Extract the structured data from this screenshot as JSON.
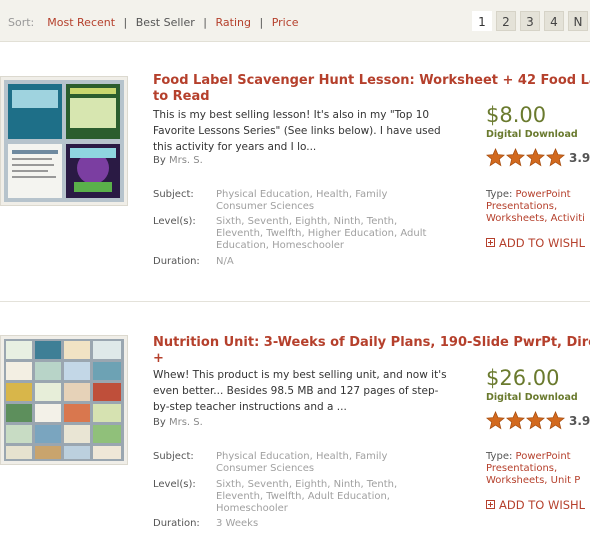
{
  "sort": {
    "label": "Sort:",
    "options": [
      "Most Recent",
      "Best Seller",
      "Rating",
      "Price"
    ],
    "separator": "|"
  },
  "pagination": {
    "pages": [
      "1",
      "2",
      "3",
      "4",
      "N"
    ],
    "current": "1"
  },
  "products": [
    {
      "title_line1": "Food Label Scavenger Hunt Lesson: Worksheet + 42 Food La",
      "title_line2": "to Read",
      "description": "This is my best selling lesson! It's also in my \"Top 10 Favorite Lessons Series\" (See links below). I have used this activity for years and I lo...",
      "by_label": "By",
      "author": "Mrs. S.",
      "subject_label": "Subject:",
      "subject": "Physical Education, Health, Family Consumer Sciences",
      "levels_label": "Level(s):",
      "levels": "Sixth, Seventh, Eighth, Ninth, Tenth, Eleventh, Twelfth, Higher Education, Adult Education, Homeschooler",
      "duration_label": "Duration:",
      "duration": "N/A",
      "price": "$8.00",
      "format": "Digital Download",
      "rating_stars": 4,
      "rating": "3.9",
      "type_label": "Type:",
      "type_line1": "PowerPoint",
      "type_line2": "Presentations,",
      "type_line3": "Worksheets, Activiti",
      "wishlist": "ADD TO WISHL"
    },
    {
      "title_line1": "Nutrition Unit: 3-Weeks of Daily Plans, 190-Slide PwrPt, Direc",
      "title_line2": "+",
      "description": "Whew! This product is my best selling unit, and now it's even better... Besides 98.5 MB and 127 pages of step-by-step teacher instructions and a ...",
      "by_label": "By",
      "author": "Mrs. S.",
      "subject_label": "Subject:",
      "subject": "Physical Education, Health, Family Consumer Sciences",
      "levels_label": "Level(s):",
      "levels": "Sixth, Seventh, Eighth, Ninth, Tenth, Eleventh, Twelfth, Adult Education, Homeschooler",
      "duration_label": "Duration:",
      "duration": "3 Weeks",
      "price": "$26.00",
      "format": "Digital Download",
      "rating_stars": 4,
      "rating": "3.9",
      "type_label": "Type:",
      "type_line1": "PowerPoint",
      "type_line2": "Presentations,",
      "type_line3": "Worksheets, Unit P",
      "wishlist": "ADD TO WISHL"
    }
  ],
  "colors": {
    "accent": "#b5402c",
    "price": "#6a7a2e",
    "star": "#d2691e"
  }
}
